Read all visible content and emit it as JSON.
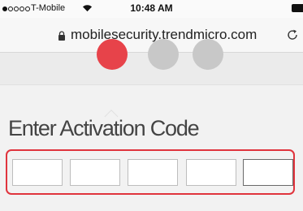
{
  "status_bar": {
    "carrier": "T-Mobile",
    "time": "10:48 AM",
    "signal_strength_bars": 1,
    "signal_total_bars": 5,
    "icons": [
      "signal-dots-icon",
      "wifi-icon",
      "battery-icon"
    ]
  },
  "browser": {
    "url": "mobilesecurity.trendmicro.com",
    "icons": [
      "lock-icon",
      "reload-icon"
    ]
  },
  "steps": {
    "total": 3,
    "current": 1,
    "active_color": "#e7434a",
    "inactive_color": "#c8c8c8"
  },
  "activation": {
    "title": "Enter Activation Code",
    "code_fields": [
      {
        "value": ""
      },
      {
        "value": ""
      },
      {
        "value": ""
      },
      {
        "value": ""
      },
      {
        "value": ""
      }
    ],
    "focused_field": 5,
    "highlight_color": "#e0343d"
  }
}
